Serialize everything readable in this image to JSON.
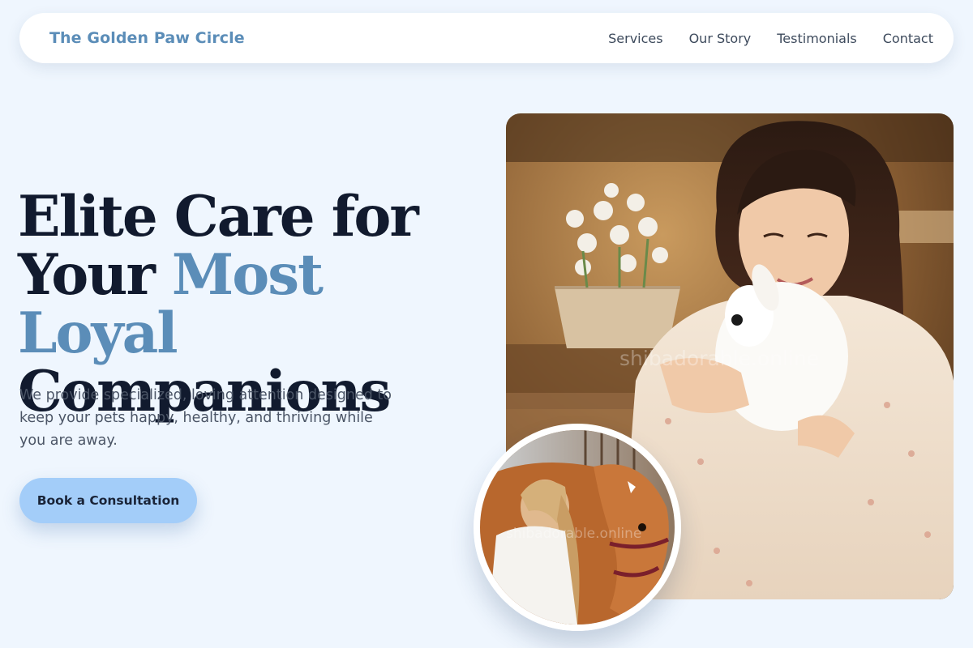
{
  "nav": {
    "logo": "The Golden Paw Circle",
    "links": [
      "Services",
      "Our Story",
      "Testimonials",
      "Contact"
    ]
  },
  "hero": {
    "title_line1": "Elite Care for",
    "title_line2_pre": "Your ",
    "title_line2_accent": "Most Loyal",
    "title_line3": "Companions",
    "description": "We provide specialized, loving attention designed to keep your pets happy, healthy, and thriving while you are away.",
    "cta_label": "Book a Consultation"
  },
  "images": {
    "main_alt": "Woman hugging a white rabbit",
    "main_watermark": "shibadorable.online",
    "secondary_alt": "Woman grooming a chestnut horse",
    "secondary_watermark": "shibadorable.online"
  },
  "colors": {
    "background": "#eff6fe",
    "accent": "#5b8db8",
    "heading": "#111a2e",
    "cta_background": "#a3cdf9"
  }
}
